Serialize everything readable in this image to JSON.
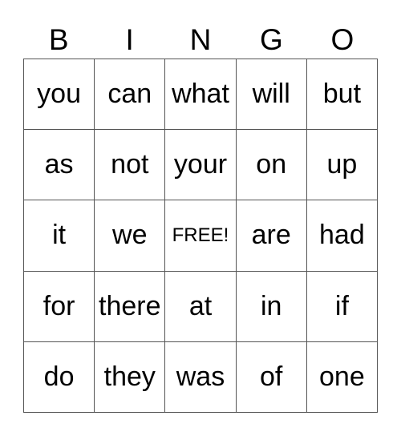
{
  "header": [
    "B",
    "I",
    "N",
    "G",
    "O"
  ],
  "free_label": "FREE!",
  "rows": [
    [
      "you",
      "can",
      "what",
      "will",
      "but"
    ],
    [
      "as",
      "not",
      "your",
      "on",
      "up"
    ],
    [
      "it",
      "we",
      "FREE!",
      "are",
      "had"
    ],
    [
      "for",
      "there",
      "at",
      "in",
      "if"
    ],
    [
      "do",
      "they",
      "was",
      "of",
      "one"
    ]
  ]
}
